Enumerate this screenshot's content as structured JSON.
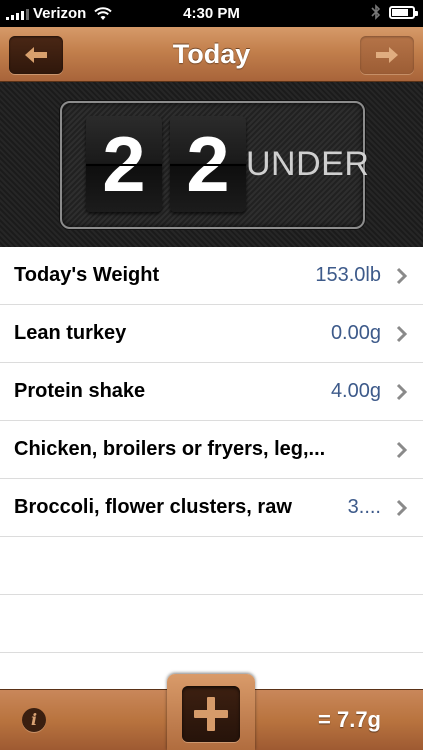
{
  "status_bar": {
    "carrier": "Verizon",
    "time": "4:30 PM",
    "icons": [
      "signal-icon",
      "wifi-icon",
      "bluetooth-icon",
      "battery-icon"
    ]
  },
  "navbar": {
    "title": "Today",
    "back_icon": "arrow-left-icon",
    "forward_icon": "arrow-right-icon"
  },
  "counter": {
    "digits": [
      "2",
      "2"
    ],
    "label": "UNDER"
  },
  "list": {
    "rows": [
      {
        "label": "Today's Weight",
        "value": "153.0lb"
      },
      {
        "label": "Lean turkey",
        "value": "0.00g"
      },
      {
        "label": "Protein shake",
        "value": "4.00g"
      },
      {
        "label": "Chicken, broilers or fryers, leg,...",
        "value": ""
      },
      {
        "label": "Broccoli, flower clusters, raw",
        "value": "3...."
      }
    ]
  },
  "toolbar": {
    "info_icon": "info-icon",
    "info_glyph": "i",
    "add_icon": "plus-icon",
    "total": "= 7.7g"
  },
  "colors": {
    "wood_light": "#d69a69",
    "wood_dark": "#a8643a",
    "value_blue": "#3d5a8a"
  }
}
